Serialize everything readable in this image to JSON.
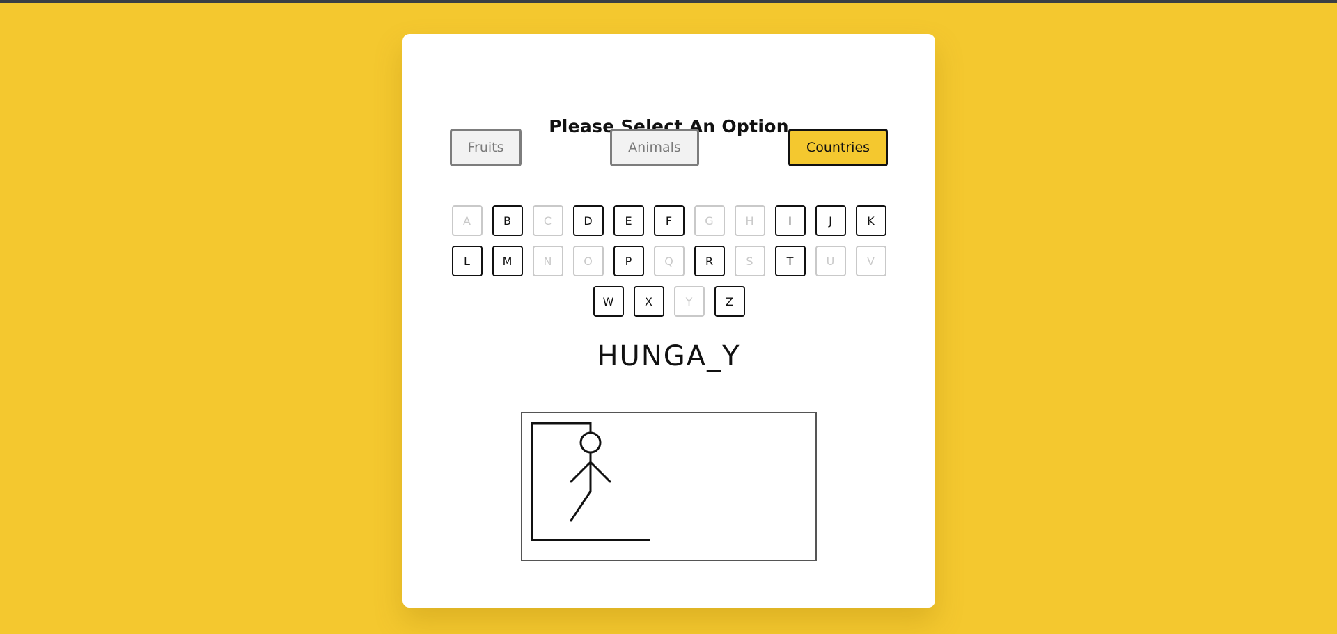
{
  "title": "Please Select An Option",
  "options": [
    {
      "label": "Fruits",
      "selected": false
    },
    {
      "label": "Animals",
      "selected": false
    },
    {
      "label": "Countries",
      "selected": true
    }
  ],
  "letters": {
    "row1": [
      {
        "char": "A",
        "used": true
      },
      {
        "char": "B",
        "used": false
      },
      {
        "char": "C",
        "used": true
      },
      {
        "char": "D",
        "used": false
      },
      {
        "char": "E",
        "used": false
      },
      {
        "char": "F",
        "used": false
      },
      {
        "char": "G",
        "used": true
      },
      {
        "char": "H",
        "used": true
      },
      {
        "char": "I",
        "used": false
      },
      {
        "char": "J",
        "used": false
      },
      {
        "char": "K",
        "used": false
      }
    ],
    "row2": [
      {
        "char": "L",
        "used": false
      },
      {
        "char": "M",
        "used": false
      },
      {
        "char": "N",
        "used": true
      },
      {
        "char": "O",
        "used": true
      },
      {
        "char": "P",
        "used": false
      },
      {
        "char": "Q",
        "used": true
      },
      {
        "char": "R",
        "used": false
      },
      {
        "char": "S",
        "used": true
      },
      {
        "char": "T",
        "used": false
      },
      {
        "char": "U",
        "used": true
      },
      {
        "char": "V",
        "used": true
      }
    ],
    "row3": [
      {
        "char": "W",
        "used": false
      },
      {
        "char": "X",
        "used": false
      },
      {
        "char": "Y",
        "used": true
      },
      {
        "char": "Z",
        "used": false
      }
    ]
  },
  "word_display": "HUNGA_Y",
  "colors": {
    "background": "#f4c82f",
    "accent": "#f4c82f",
    "disabled": "#c9c9c9"
  },
  "hangman": {
    "wrong_guesses": 5,
    "parts_drawn": [
      "base",
      "pole",
      "beam",
      "rope",
      "head",
      "body",
      "left-arm",
      "right-arm",
      "left-leg"
    ]
  }
}
